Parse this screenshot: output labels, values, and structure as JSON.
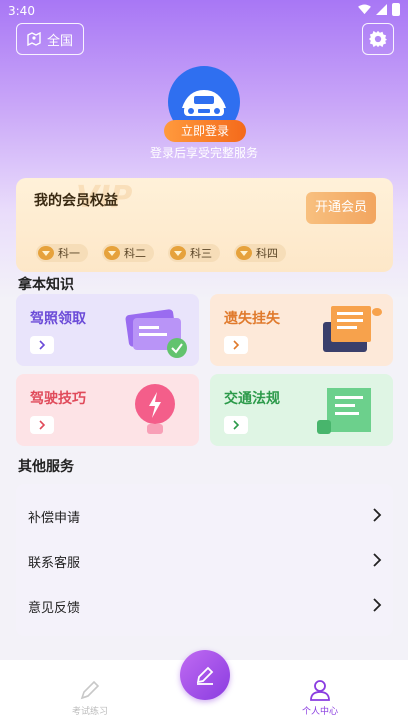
{
  "status_bar": {
    "time": "3:40"
  },
  "header": {
    "region_label": "全国"
  },
  "profile": {
    "login_button": "立即登录",
    "login_hint": "登录后享受完整服务"
  },
  "vip": {
    "title": "我的会员权益",
    "bg_text": "VIP",
    "open_button": "开通会员",
    "tags": [
      "科一",
      "科二",
      "科三",
      "科四"
    ]
  },
  "knowledge": {
    "title": "拿本知识",
    "tiles": [
      {
        "label": "驾照领取",
        "color": "#6b4bd8",
        "bg": "#e9e4fb"
      },
      {
        "label": "遗失挂失",
        "color": "#e07a2c",
        "bg": "#fde9d9"
      },
      {
        "label": "驾驶技巧",
        "color": "#e04a5a",
        "bg": "#fde3e6"
      },
      {
        "label": "交通法规",
        "color": "#2c9a4a",
        "bg": "#dff5e4"
      }
    ]
  },
  "services": {
    "title": "其他服务",
    "items": [
      "补偿申请",
      "联系客服",
      "意见反馈"
    ]
  },
  "tabbar": {
    "items": [
      {
        "label": "考试练习",
        "active": false
      },
      {
        "label": "个人中心",
        "active": true
      }
    ],
    "accent": "#8a3ce0"
  }
}
